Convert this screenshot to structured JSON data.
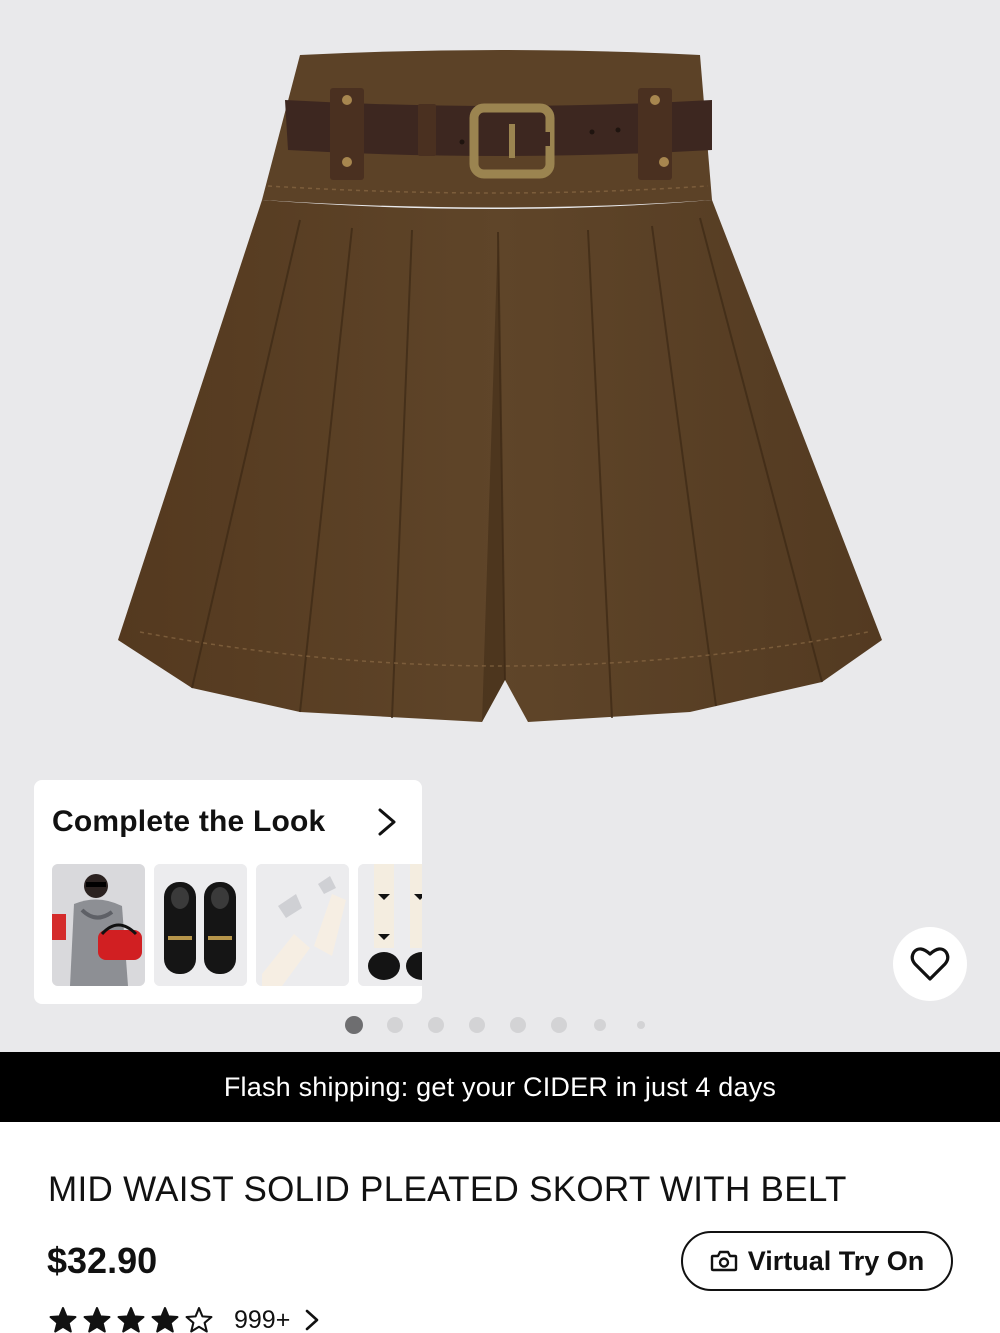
{
  "complete_the_look": {
    "title": "Complete the Look"
  },
  "carousel": {
    "total_images": 8,
    "active_index": 0
  },
  "shipping_banner": {
    "text": "Flash shipping: get your CIDER in just 4 days"
  },
  "product": {
    "title": "MID WAIST SOLID PLEATED SKORT WITH BELT",
    "price": "$32.90",
    "rating": 4,
    "review_count": "999+"
  },
  "virtual_try_on": {
    "label": "Virtual Try On"
  },
  "icons": [
    "chevron-right-icon",
    "heart-icon",
    "camera-icon",
    "star-icon"
  ],
  "colors": {
    "skirt_brown": "#5a4128",
    "belt_brown": "#3d2720",
    "hero_bg": "#e9e9eb",
    "banner_bg": "#000000"
  }
}
